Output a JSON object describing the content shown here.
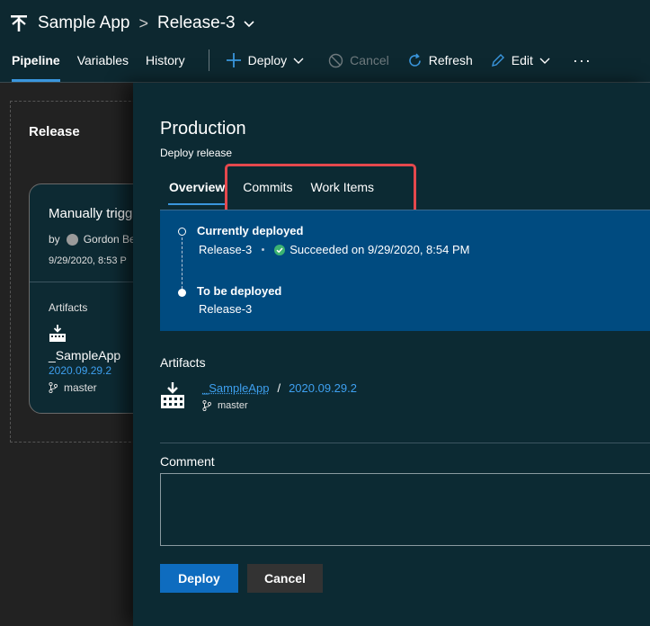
{
  "header": {
    "app_name": "Sample App",
    "release_name": "Release-3"
  },
  "toolbar": {
    "tabs": [
      {
        "label": "Pipeline",
        "active": true
      },
      {
        "label": "Variables",
        "active": false
      },
      {
        "label": "History",
        "active": false
      }
    ],
    "deploy_label": "Deploy",
    "cancel_label": "Cancel",
    "refresh_label": "Refresh",
    "edit_label": "Edit",
    "more_label": "···"
  },
  "canvas": {
    "stage_label": "Release",
    "card": {
      "trigger_text": "Manually trigg",
      "by_prefix": "by",
      "by_user": "Gordon Be",
      "date": "9/29/2020, 8:53 P",
      "artifacts_label": "Artifacts",
      "artifact_name": "_SampleApp",
      "artifact_version": "2020.09.29.2",
      "branch": "master"
    }
  },
  "panel": {
    "title": "Production",
    "subtitle": "Deploy release",
    "tabs": [
      {
        "label": "Overview",
        "active": true
      },
      {
        "label": "Commits",
        "active": false
      },
      {
        "label": "Work Items",
        "active": false
      }
    ],
    "status": {
      "current_label": "Currently deployed",
      "current_release": "Release-3",
      "current_result": "Succeeded on 9/29/2020, 8:54 PM",
      "next_label": "To be deployed",
      "next_release": "Release-3"
    },
    "artifacts": {
      "heading": "Artifacts",
      "name": "_SampleApp",
      "separator": "/",
      "version": "2020.09.29.2",
      "branch": "master"
    },
    "comment": {
      "label": "Comment",
      "value": ""
    },
    "deploy_button": "Deploy",
    "cancel_button": "Cancel"
  },
  "colors": {
    "header_bg": "#0d2830",
    "panel_bg": "#0c2a33",
    "status_bg": "#004b80",
    "accent": "#3a96dd",
    "link": "#3ea0f0",
    "primary_button": "#0e6cbf",
    "highlight_border": "#e5484d",
    "success": "#3cb371"
  },
  "icons": [
    "release-pipeline-icon",
    "chevron-down-icon",
    "plus-icon",
    "cancel-circle-icon",
    "refresh-icon",
    "edit-pencil-icon",
    "more-icon",
    "build-artifact-icon",
    "branch-icon",
    "success-check-icon"
  ]
}
